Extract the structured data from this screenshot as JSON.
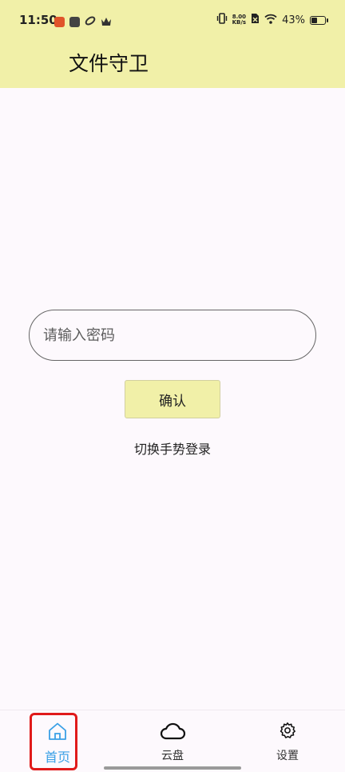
{
  "status_bar": {
    "time": "11:50",
    "net_speed_value": "8.00",
    "net_speed_unit": "KB/s",
    "battery": "43%"
  },
  "header": {
    "title": "文件守卫"
  },
  "login": {
    "password_placeholder": "请输入密码",
    "confirm_label": "确认",
    "switch_gesture_label": "切换手势登录"
  },
  "bottom_nav": {
    "items": [
      {
        "label": "首页",
        "icon": "home-icon",
        "active": true
      },
      {
        "label": "云盘",
        "icon": "cloud-icon",
        "active": false
      },
      {
        "label": "设置",
        "icon": "gear-icon",
        "active": false
      }
    ]
  },
  "colors": {
    "header_bg": "#f1f0a8",
    "page_bg": "#fdf9fd",
    "active_nav": "#3aa0e6",
    "highlight_box": "#e01a1a"
  }
}
